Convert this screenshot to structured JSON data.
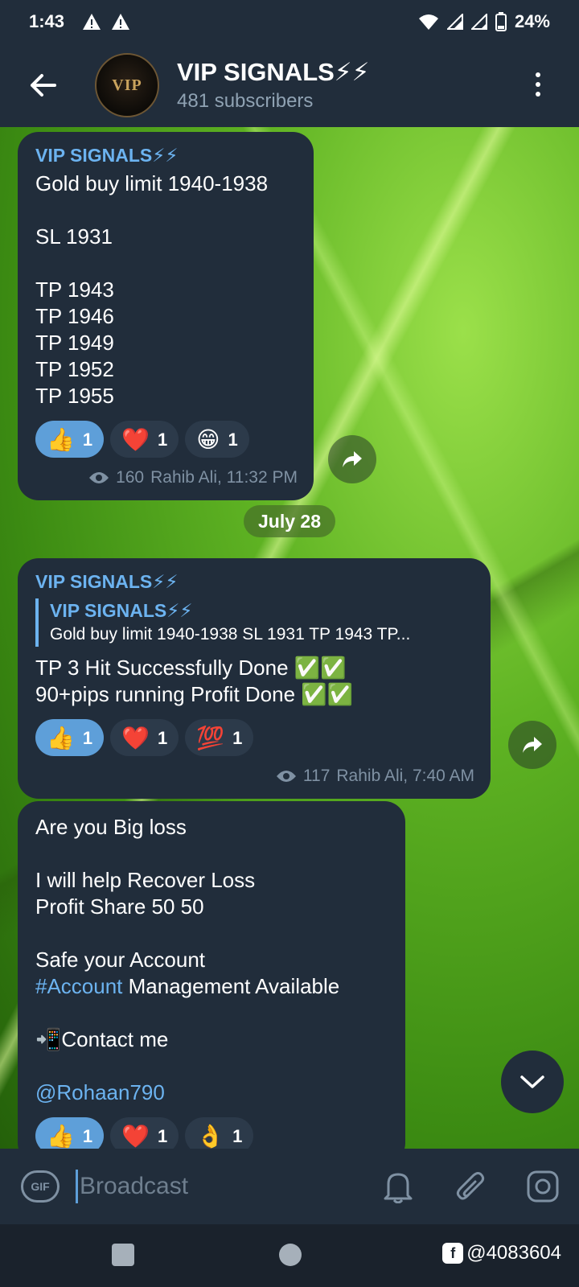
{
  "status_bar": {
    "time": "1:43",
    "battery": "24%"
  },
  "header": {
    "title": "VIP SIGNALS⚡⚡",
    "subtitle": "481 subscribers",
    "avatar_text": "VIP"
  },
  "messages": [
    {
      "sender": "VIP SIGNALS⚡⚡",
      "body": "Gold buy limit 1940-1938\n\nSL 1931\n\nTP 1943\nTP 1946\nTP 1949\nTP 1952\nTP 1955",
      "reactions": [
        {
          "emoji": "👍",
          "count": "1"
        },
        {
          "emoji": "❤️",
          "count": "1"
        },
        {
          "emoji": "😁",
          "count": "1"
        }
      ],
      "views": "160",
      "footer": "Rahib Ali, 11:32 PM"
    },
    {
      "sender": "VIP SIGNALS⚡⚡",
      "quote_title": "VIP SIGNALS⚡⚡",
      "quote_body": "Gold buy limit 1940-1938  SL 1931  TP 1943 TP...",
      "body": "TP 3 Hit Successfully Done ✅✅\n90+pips running Profit Done ✅✅",
      "reactions": [
        {
          "emoji": "👍",
          "count": "1"
        },
        {
          "emoji": "❤️",
          "count": "1"
        },
        {
          "emoji": "💯",
          "count": "1"
        }
      ],
      "views": "117",
      "footer": "Rahib Ali, 7:40 AM"
    },
    {
      "line1": "Are you Big loss",
      "line2": "I will help Recover Loss",
      "line3": "Profit Share 50 50",
      "line4": "Safe your Account",
      "hashtag": "#Account",
      "line5_rest": " Management Available",
      "contact": "📲Contact me",
      "mention": "@Rohaan790",
      "reactions": [
        {
          "emoji": "👍",
          "count": "1"
        },
        {
          "emoji": "❤️",
          "count": "1"
        },
        {
          "emoji": "👌",
          "count": "1"
        }
      ]
    }
  ],
  "date_chip": "July 28",
  "input": {
    "placeholder": "Broadcast",
    "gif_label": "GIF"
  },
  "watermark": "@4083604",
  "colors": {
    "accent": "#6cb3f0",
    "bubble": "#212d3b",
    "bar": "#212d3b",
    "reaction_mine": "#5e9fd9"
  },
  "icons": [
    "back-arrow-icon",
    "more-vert-icon",
    "eye-icon",
    "share-arrow-icon",
    "chevron-down-icon",
    "gif-icon",
    "bell-icon",
    "paperclip-icon",
    "camera-icon"
  ]
}
